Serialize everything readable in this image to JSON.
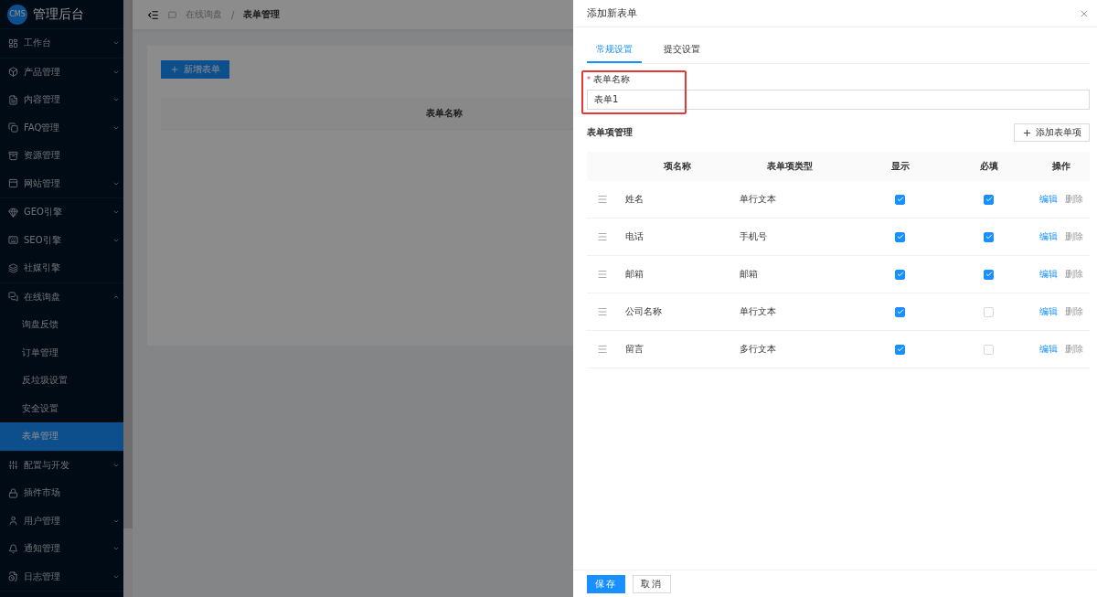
{
  "sidebar": {
    "logo": {
      "badge": "CMS",
      "title": "管理后台"
    },
    "groups": [
      [
        {
          "label": "工作台",
          "expanded": false
        }
      ],
      [
        {
          "label": "产品管理",
          "expanded": false
        },
        {
          "label": "内容管理",
          "expanded": false
        },
        {
          "label": "FAQ管理",
          "expanded": false
        },
        {
          "label": "资源管理"
        },
        {
          "label": "网站管理",
          "expanded": false
        }
      ],
      [
        {
          "label": "GEO引擎",
          "expanded": false
        },
        {
          "label": "SEO引擎",
          "expanded": false
        },
        {
          "label": "社媒引擎"
        }
      ],
      [
        {
          "label": "在线询盘",
          "expanded": true,
          "children": [
            {
              "label": "询盘反馈",
              "selected": false
            },
            {
              "label": "订单管理",
              "selected": false
            },
            {
              "label": "反垃圾设置",
              "selected": false
            },
            {
              "label": "安全设置",
              "selected": false
            },
            {
              "label": "表单管理",
              "selected": true
            }
          ]
        }
      ],
      [
        {
          "label": "配置与开发",
          "expanded": false
        },
        {
          "label": "插件市场"
        },
        {
          "label": "用户管理",
          "expanded": false
        },
        {
          "label": "通知管理",
          "expanded": false
        },
        {
          "label": "日志管理",
          "expanded": false
        }
      ]
    ]
  },
  "header": {
    "breadcrumb": [
      "在线询盘",
      "表单管理"
    ],
    "separator": "/"
  },
  "page": {
    "add_button": "新增表单",
    "table": {
      "columns": [
        "表单名称"
      ]
    }
  },
  "drawer": {
    "title": "添加新表单",
    "tabs": [
      {
        "label": "常规设置",
        "selected": true
      },
      {
        "label": "提交设置",
        "selected": false
      }
    ],
    "form_name": {
      "required_mark": "*",
      "label": "表单名称",
      "value": "表单1"
    },
    "items_section": {
      "title": "表单项管理",
      "add_button": "添加表单项",
      "columns": [
        "项名称",
        "表单项类型",
        "显示",
        "必填",
        "操作"
      ],
      "rows": [
        {
          "name": "姓名",
          "type": "单行文本",
          "visible": true,
          "required": true,
          "actions": [
            {
              "label": "编辑",
              "disabled": false
            },
            {
              "label": "删除",
              "disabled": true
            }
          ]
        },
        {
          "name": "电话",
          "type": "手机号",
          "visible": true,
          "required": true,
          "actions": [
            {
              "label": "编辑",
              "disabled": false
            },
            {
              "label": "删除",
              "disabled": true
            }
          ]
        },
        {
          "name": "邮箱",
          "type": "邮箱",
          "visible": true,
          "required": true,
          "actions": [
            {
              "label": "编辑",
              "disabled": false
            },
            {
              "label": "删除",
              "disabled": true
            }
          ]
        },
        {
          "name": "公司名称",
          "type": "单行文本",
          "visible": true,
          "required": false,
          "actions": [
            {
              "label": "编辑",
              "disabled": false
            },
            {
              "label": "删除",
              "disabled": true
            }
          ]
        },
        {
          "name": "留言",
          "type": "多行文本",
          "visible": true,
          "required": false,
          "actions": [
            {
              "label": "编辑",
              "disabled": false
            },
            {
              "label": "删除",
              "disabled": true
            }
          ]
        }
      ]
    },
    "footer": {
      "buttons": [
        {
          "label": "保存",
          "kind": "primary"
        },
        {
          "label": "取消",
          "kind": "default"
        }
      ]
    }
  }
}
